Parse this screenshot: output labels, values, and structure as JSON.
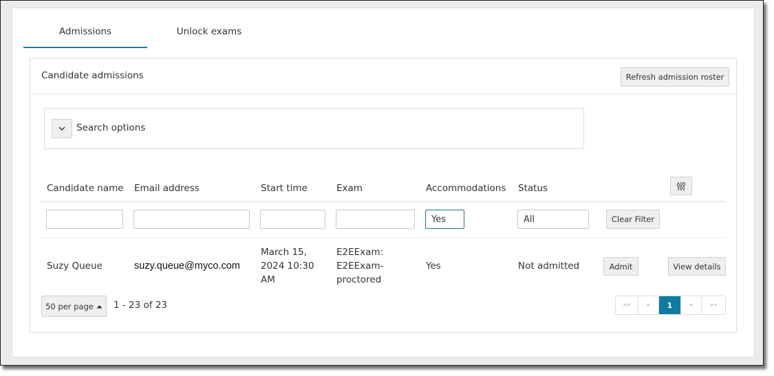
{
  "tabs": [
    {
      "label": "Admissions",
      "active": true
    },
    {
      "label": "Unlock exams",
      "active": false
    }
  ],
  "panel": {
    "title": "Candidate admissions",
    "refresh_label": "Refresh admission roster"
  },
  "search": {
    "toggle_icon": "chevron-down-icon",
    "label": "Search options"
  },
  "table": {
    "columns": [
      "Candidate name",
      "Email address",
      "Start time",
      "Exam",
      "Accommodations",
      "Status"
    ],
    "column_settings_icon": "sliders-icon",
    "filters": {
      "candidate_name": "",
      "email_address": "",
      "start_time": "",
      "exam": "",
      "accommodations": "Yes",
      "status": "All"
    },
    "clear_filter_label": "Clear Filter",
    "rows": [
      {
        "candidate_name": "Suzy Queue",
        "email": "suzy.queue@myco.com",
        "start_time_lines": [
          "March 15,",
          "2024 10:30",
          "AM"
        ],
        "exam_lines": [
          "E2EExam:",
          "E2EExam-",
          "proctored"
        ],
        "accommodations": "Yes",
        "status": "Not admitted",
        "admit_label": "Admit",
        "details_label": "View details"
      }
    ]
  },
  "pagination": {
    "per_page_label": "50 per page",
    "per_page_icon": "caret-up-icon",
    "range_text": "1 - 23 of 23",
    "first_label": "««",
    "prev_label": "«",
    "current_page": "1",
    "next_label": "»",
    "last_label": "»»"
  },
  "colors": {
    "accent": "#0f7ba1",
    "tab_underline": "#1a7fa8"
  }
}
